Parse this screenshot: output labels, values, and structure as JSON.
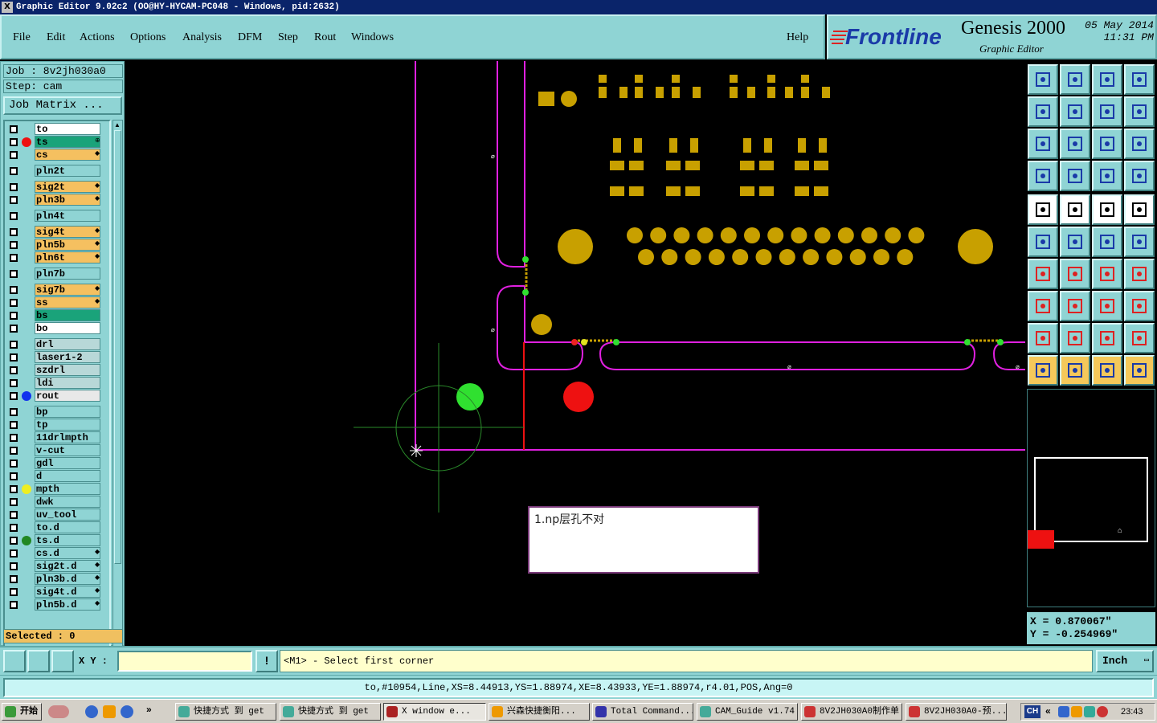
{
  "window": {
    "title": "Graphic Editor 9.02c2  (OO@HY-HYCAM-PC048 - Windows, pid:2632)",
    "icon": "x-icon"
  },
  "menu": {
    "items": [
      "File",
      "Edit",
      "Actions",
      "Options",
      "Analysis",
      "DFM",
      "Step",
      "Rout",
      "Windows"
    ],
    "help": "Help"
  },
  "brand": {
    "logo": "Frontline",
    "product": "Genesis 2000",
    "subtitle": "Graphic Editor",
    "date": "05 May 2014",
    "time": "11:31 PM"
  },
  "job": {
    "job_label": "Job : 8v2jh030a0",
    "step_label": "Step: cam",
    "matrix_button": "Job Matrix ..."
  },
  "layers": [
    {
      "name": "to",
      "bg": "#ffffff",
      "dot": "",
      "mark": ""
    },
    {
      "name": "ts",
      "bg": "#1aa37a",
      "dot": "#ee1111",
      "mark": "⊕"
    },
    {
      "name": "cs",
      "bg": "#f5c060",
      "dot": "",
      "mark": "◆"
    },
    {
      "name": "pln2t",
      "bg": "#8fd4d4",
      "dot": "",
      "mark": ""
    },
    {
      "name": "sig2t",
      "bg": "#f5c060",
      "dot": "",
      "mark": "◆"
    },
    {
      "name": "pln3b",
      "bg": "#f5c060",
      "dot": "",
      "mark": "◆"
    },
    {
      "name": "pln4t",
      "bg": "#8fd4d4",
      "dot": "",
      "mark": ""
    },
    {
      "name": "sig4t",
      "bg": "#f5c060",
      "dot": "",
      "mark": "◆"
    },
    {
      "name": "pln5b",
      "bg": "#f5c060",
      "dot": "",
      "mark": "◆"
    },
    {
      "name": "pln6t",
      "bg": "#f5c060",
      "dot": "",
      "mark": "◆"
    },
    {
      "name": "pln7b",
      "bg": "#8fd4d4",
      "dot": "",
      "mark": ""
    },
    {
      "name": "sig7b",
      "bg": "#f5c060",
      "dot": "",
      "mark": "◆"
    },
    {
      "name": "ss",
      "bg": "#f5c060",
      "dot": "",
      "mark": "◆"
    },
    {
      "name": "bs",
      "bg": "#1aa37a",
      "dot": "",
      "mark": ""
    },
    {
      "name": "bo",
      "bg": "#ffffff",
      "dot": "",
      "mark": ""
    },
    {
      "name": "drl",
      "bg": "#b8d8d8",
      "dot": "",
      "mark": ""
    },
    {
      "name": "laser1-2",
      "bg": "#b8d8d8",
      "dot": "",
      "mark": ""
    },
    {
      "name": "szdrl",
      "bg": "#b8d8d8",
      "dot": "",
      "mark": ""
    },
    {
      "name": "ldi",
      "bg": "#b8d8d8",
      "dot": "",
      "mark": ""
    },
    {
      "name": "rout",
      "bg": "#e8e8e8",
      "dot": "#1133ee",
      "mark": ""
    },
    {
      "name": "bp",
      "bg": "#8fd4d4",
      "dot": "",
      "mark": ""
    },
    {
      "name": "tp",
      "bg": "#8fd4d4",
      "dot": "",
      "mark": ""
    },
    {
      "name": "11drlmpth",
      "bg": "#8fd4d4",
      "dot": "",
      "mark": ""
    },
    {
      "name": "v-cut",
      "bg": "#8fd4d4",
      "dot": "",
      "mark": ""
    },
    {
      "name": "gdl",
      "bg": "#8fd4d4",
      "dot": "",
      "mark": ""
    },
    {
      "name": "d",
      "bg": "#8fd4d4",
      "dot": "",
      "mark": ""
    },
    {
      "name": "mpth",
      "bg": "#8fd4d4",
      "dot": "#eeee22",
      "mark": ""
    },
    {
      "name": "dwk",
      "bg": "#8fd4d4",
      "dot": "",
      "mark": ""
    },
    {
      "name": "uv_tool",
      "bg": "#8fd4d4",
      "dot": "",
      "mark": ""
    },
    {
      "name": "to.d",
      "bg": "#8fd4d4",
      "dot": "",
      "mark": ""
    },
    {
      "name": "ts.d",
      "bg": "#8fd4d4",
      "dot": "#228822",
      "mark": ""
    },
    {
      "name": "cs.d",
      "bg": "#8fd4d4",
      "dot": "",
      "mark": "◆"
    },
    {
      "name": "sig2t.d",
      "bg": "#8fd4d4",
      "dot": "",
      "mark": "◆"
    },
    {
      "name": "pln3b.d",
      "bg": "#8fd4d4",
      "dot": "",
      "mark": "◆"
    },
    {
      "name": "sig4t.d",
      "bg": "#8fd4d4",
      "dot": "",
      "mark": "◆"
    },
    {
      "name": "pln5b.d",
      "bg": "#8fd4d4",
      "dot": "",
      "mark": "◆"
    }
  ],
  "selected_label": "Selected : 0",
  "coords": {
    "x": "X = 0.870067\"",
    "y": "Y = -0.254969\""
  },
  "cmd": {
    "xy_label": "X Y :",
    "xy_value": "",
    "prompt": "<M1> - Select first corner",
    "unit": "Inch"
  },
  "status": "to,#10954,Line,XS=8.44913,YS=1.88974,XE=8.43933,YE=1.88974,r4.01,POS,Ang=0",
  "note": "1.np层孔不对",
  "toolbar_icons": [
    "open-job-icon",
    "save-icon",
    "home-icon",
    "window-icon",
    "zoom-in-icon",
    "zoom-out-icon",
    "mirror-icon",
    "refresh-icon",
    "fit-icon",
    "center-icon",
    "ratio-icon",
    "help-icon",
    "settings-icon",
    "grid-icon",
    "layer-icon",
    "layer2-icon",
    "pad-icon",
    "edit-icon",
    "measure-icon",
    "circle-icon",
    "node-icon",
    "cross-icon",
    "move-icon",
    "rotate-icon",
    "angle-icon",
    "line-icon",
    "arc-icon",
    "flip-icon",
    "add-icon",
    "minus-icon",
    "resize-icon",
    "copy-icon",
    "triangle-icon",
    "triangle2-icon",
    "triangle3-icon",
    "triangle4-icon",
    "pointer-icon",
    "pointer2-icon",
    "pointer3-icon",
    "select-icon"
  ],
  "taskbar": {
    "start": "开始",
    "tasks": [
      "快捷方式 到 get",
      "快捷方式 到 get",
      "X window e...",
      "兴森快捷衡阳...",
      "Total Command...",
      "CAM_Guide v1.74",
      "8V2JH030A0制作单",
      "8V2JH030A0-预..."
    ],
    "lang": "CH",
    "clock": "23:43"
  }
}
